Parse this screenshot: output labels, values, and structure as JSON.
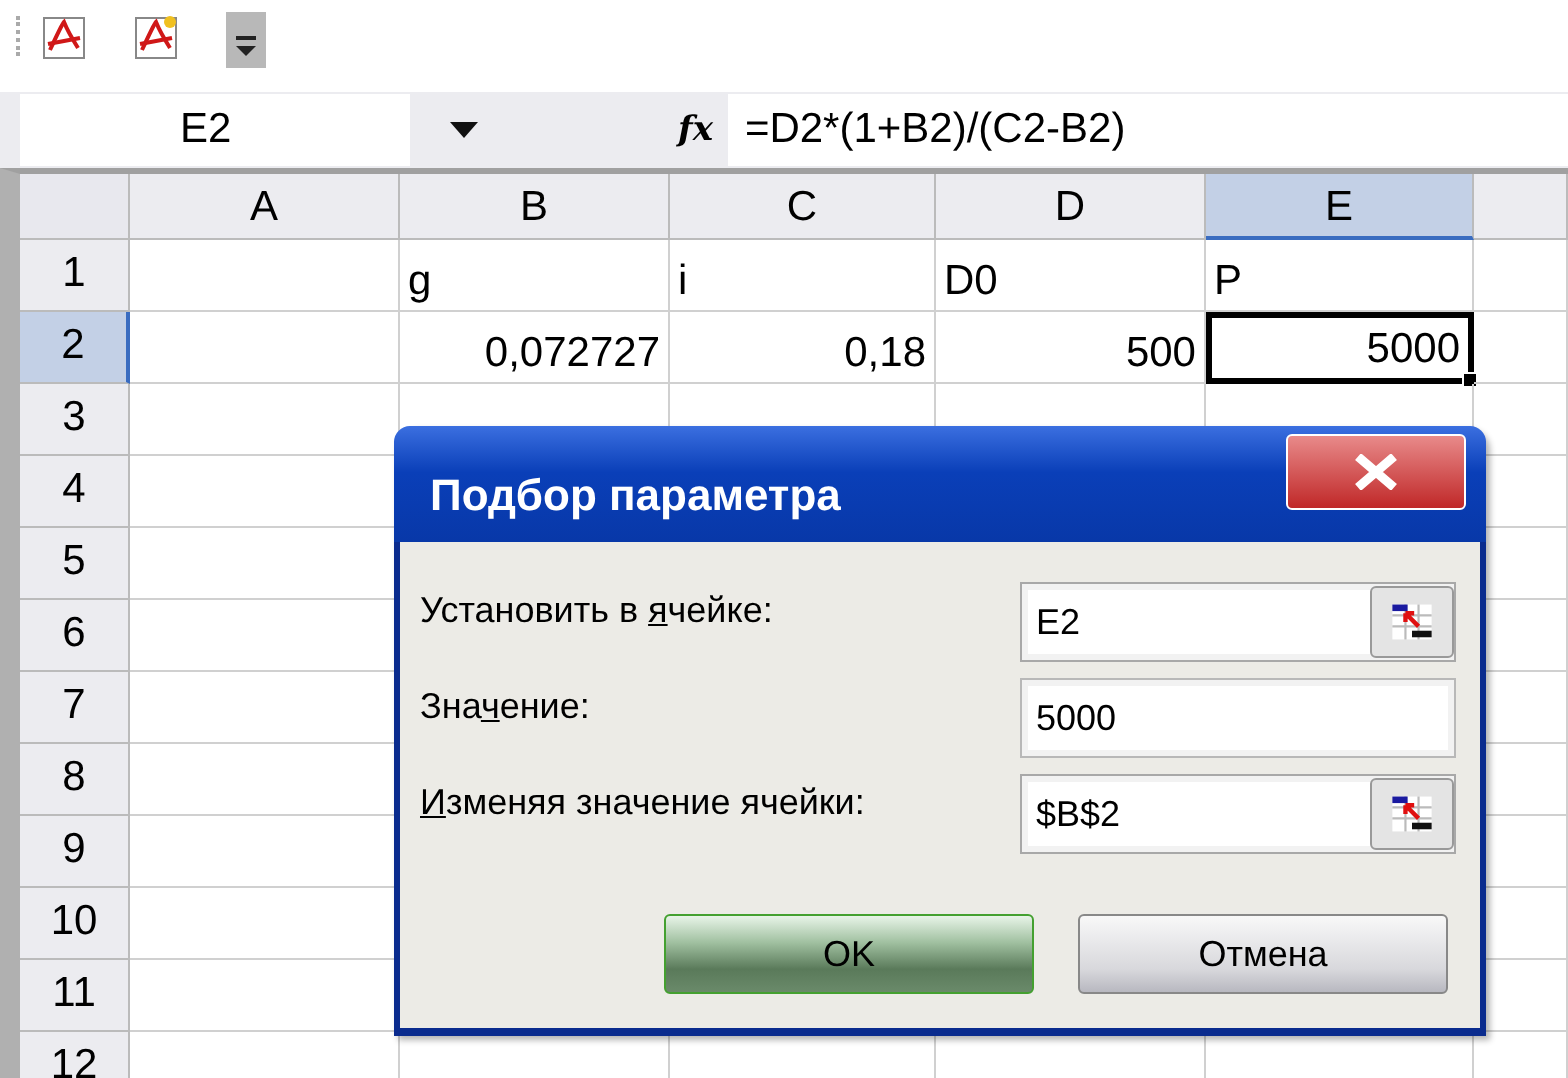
{
  "toolbar": {
    "buttons": [
      {
        "kind": "pdf"
      },
      {
        "kind": "pdf-star"
      },
      {
        "kind": "overflow"
      }
    ]
  },
  "formula_bar": {
    "name_box": "E2",
    "function_label": "fx",
    "formula": "=D2*(1+B2)/(C2-B2)"
  },
  "sheet": {
    "columns": [
      {
        "label": "A",
        "selected": false
      },
      {
        "label": "B",
        "selected": false
      },
      {
        "label": "C",
        "selected": false
      },
      {
        "label": "D",
        "selected": false
      },
      {
        "label": "E",
        "selected": true
      }
    ],
    "rows": [
      {
        "label": "1",
        "selected": false,
        "cells": [
          null,
          {
            "text": "g",
            "kind": "text",
            "active": false
          },
          {
            "text": "i",
            "kind": "text",
            "active": false
          },
          {
            "text": "D0",
            "kind": "text",
            "active": false
          },
          {
            "text": "P",
            "kind": "text",
            "active": false
          }
        ]
      },
      {
        "label": "2",
        "selected": true,
        "cells": [
          null,
          {
            "text": "0,072727",
            "kind": "number",
            "active": false
          },
          {
            "text": "0,18",
            "kind": "number",
            "active": false
          },
          {
            "text": "500",
            "kind": "number",
            "active": false
          },
          {
            "text": "5000",
            "kind": "number",
            "active": true
          }
        ]
      },
      {
        "label": "3",
        "selected": false
      },
      {
        "label": "4",
        "selected": false
      },
      {
        "label": "5",
        "selected": false
      },
      {
        "label": "6",
        "selected": false
      },
      {
        "label": "7",
        "selected": false
      },
      {
        "label": "8",
        "selected": false
      },
      {
        "label": "9",
        "selected": false
      },
      {
        "label": "10",
        "selected": false
      },
      {
        "label": "11",
        "selected": false
      },
      {
        "label": "12",
        "selected": false
      }
    ]
  },
  "dialog": {
    "title": "Подбор параметра",
    "fields": [
      {
        "label_before": "Установить в ",
        "label_key": "я",
        "label_after": "чейке:",
        "value": "E2",
        "ref_button": true
      },
      {
        "label_before": "Зна",
        "label_key": "ч",
        "label_after": "ение:",
        "value": "5000",
        "ref_button": false
      },
      {
        "label_key": "И",
        "label_after": "зменяя значение ячейки:",
        "value": "$B$2",
        "ref_button": true
      }
    ],
    "buttons": [
      {
        "label": "OK",
        "default": true
      },
      {
        "label": "Отмена",
        "default": false
      }
    ]
  }
}
